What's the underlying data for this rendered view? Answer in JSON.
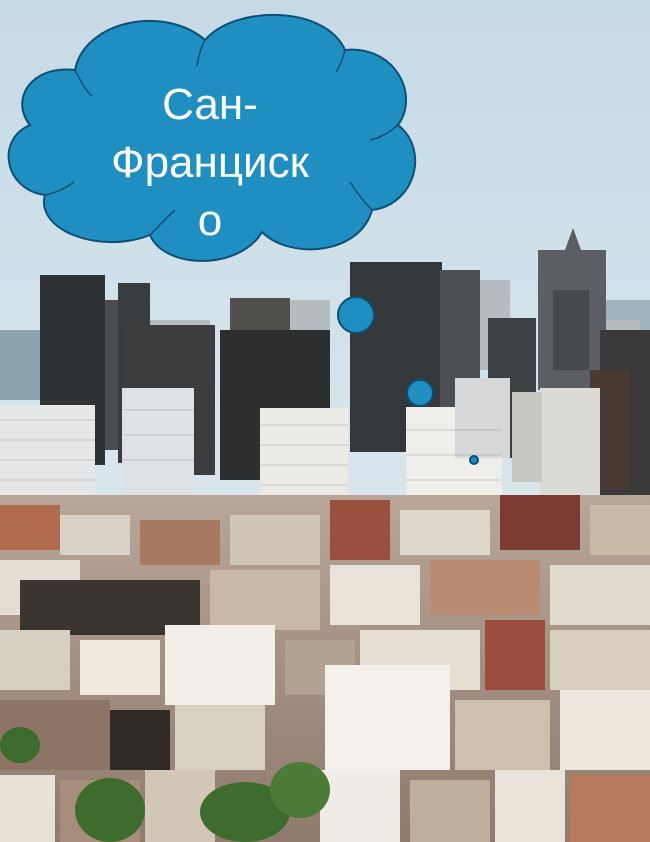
{
  "callout": {
    "text": "Сан-\nФранциск\nо",
    "fill_color": "#1f8fc2",
    "stroke_color": "#0e4f73",
    "text_color": "#ffffff"
  },
  "photo": {
    "sky_color": "#cfe0ea",
    "bay_color": "#7f9aa6",
    "tower_dark": "#2c2f33",
    "tower_light": "#e9e6df",
    "rooftop_warm": "#a8654b",
    "tree_color": "#3e6b2e"
  }
}
